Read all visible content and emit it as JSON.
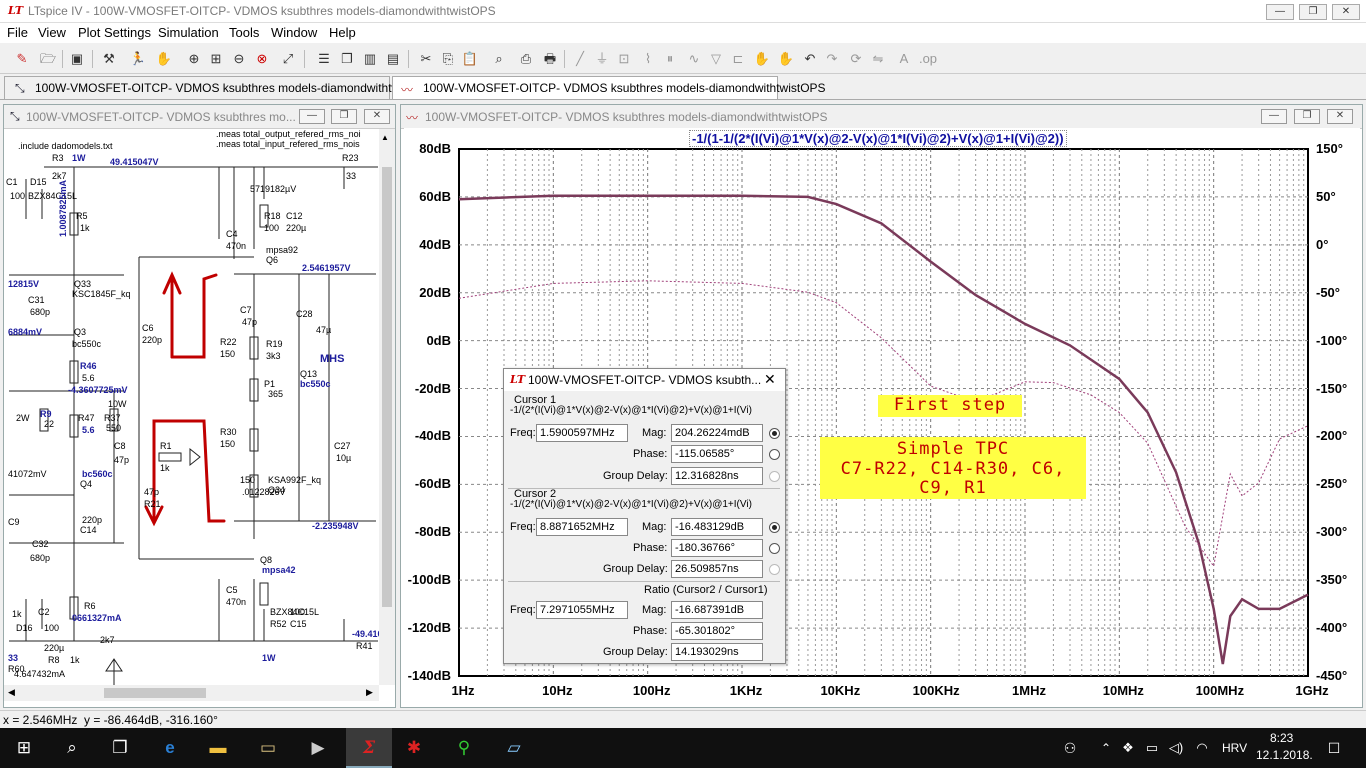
{
  "app": {
    "window_title": "LTspice IV - 100W-VMOSFET-OITCP- VDMOS ksubthres models-diamondwithtwistOPS",
    "window_buttons": [
      "—",
      "❐",
      "✕"
    ]
  },
  "menus": [
    "File",
    "View",
    "Plot Settings",
    "Simulation",
    "Tools",
    "Window",
    "Help"
  ],
  "tabs": [
    {
      "label": "100W-VMOSFET-OITCP- VDMOS ksubthres models-diamondwithtwistOPS",
      "icon": "schematic-icon"
    },
    {
      "label": "100W-VMOSFET-OITCP- VDMOS ksubthres models-diamondwithtwistOPS",
      "icon": "waveform-icon"
    }
  ],
  "schematic_window": {
    "title": "100W-VMOSFET-OITCP- VDMOS ksubthres mo...",
    "labels": [
      ".include dadomodels.txt",
      ".meas total_output_refered_rms_noi",
      ".meas total_input_refered_rms_nois",
      "R3",
      "2k7",
      "1W",
      "49.415047V",
      "R23",
      "33",
      "C1",
      "D15",
      "100",
      "BZX84C15L",
      "R5",
      "1k",
      "1.0087825mA",
      "C4",
      "470n",
      "R18",
      "100",
      "C12",
      "220µ",
      "mpsa92",
      "Q6",
      "2.5461957V",
      "12815V",
      "Q33",
      "KSC1845F_kq",
      "C31",
      "680p",
      "6884mV",
      "Q3",
      "bc550c",
      "C6",
      "220p",
      "C7",
      "47p",
      "C28",
      "47µ",
      "R22",
      "150",
      "R19",
      "3k3",
      "MHS",
      "R46",
      "5.6",
      "-4.3607725mV",
      "P1",
      "365",
      "Q13",
      "bc550c",
      "2W",
      "R9",
      "22",
      "10W",
      "R47",
      "5.6",
      "R37",
      "550",
      "C8",
      "47p",
      "R1",
      "1k",
      "R30",
      "150",
      "C27",
      "10µ",
      "41072mV",
      "bc560c",
      "Q4",
      "C9",
      "220p",
      "C14",
      "47p",
      "R21",
      "150",
      ".0122826V",
      "KSA992F_kq",
      "Q34",
      "-2.235948V",
      "C32",
      "680p",
      "Q8",
      "mpsa42",
      "C5",
      "470n",
      "0661327mA",
      "R6",
      "1k",
      "C2",
      "D16",
      "100",
      "BZX84C15L",
      "R52",
      "100",
      "C15",
      "220µ",
      "R8",
      "2k7",
      "-49.410865V",
      "R41",
      "33",
      "R60",
      "1k",
      "1W",
      "5719182µV",
      "4.647432mA"
    ]
  },
  "plot_window": {
    "title": "100W-VMOSFET-OITCP- VDMOS ksubthres models-diamondwithtwistOPS",
    "trace_expression": "-1/(1-1/(2*(I(Vi)@1*V(x)@2-V(x)@1*I(Vi)@2)+V(x)@1+I(Vi)@2))"
  },
  "chart_data": {
    "type": "line",
    "title": "-1/(1-1/(2*(I(Vi)@1*V(x)@2-V(x)@1*I(Vi)@2)+V(x)@1+I(Vi)@2))",
    "x_scale": "log",
    "xlim_hz": [
      1,
      1000000000
    ],
    "x_ticks": [
      "1Hz",
      "10Hz",
      "100Hz",
      "1KHz",
      "10KHz",
      "100KHz",
      "1MHz",
      "10MHz",
      "100MHz",
      "1GHz"
    ],
    "ylim_db": [
      -140,
      80
    ],
    "y_ticks": [
      "80dB",
      "60dB",
      "40dB",
      "20dB",
      "0dB",
      "-20dB",
      "-40dB",
      "-60dB",
      "-80dB",
      "-100dB",
      "-120dB",
      "-140dB"
    ],
    "y2lim_deg": [
      -450,
      150
    ],
    "y2_ticks": [
      "150°",
      "50°",
      "0°",
      "-50°",
      "-100°",
      "-150°",
      "-200°",
      "-250°",
      "-300°",
      "-350°",
      "-400°",
      "-450°"
    ],
    "grid": true,
    "series": [
      {
        "name": "magnitude",
        "axis": "left",
        "color": "#7a3a5a",
        "style": "solid",
        "x": [
          1,
          10,
          100,
          1000,
          5000,
          10000,
          30000,
          100000,
          300000,
          1000000,
          3000000,
          10000000,
          20000000,
          40000000,
          70000000,
          100000000,
          125000000,
          150000000,
          200000000,
          300000000,
          500000000,
          1000000000
        ],
        "y": [
          59,
          60.5,
          60.5,
          60.5,
          60,
          57,
          49,
          33,
          19,
          7,
          -2,
          -16,
          -30,
          -55,
          -85,
          -112,
          -135,
          -115,
          -108,
          -112,
          -112,
          -106
        ]
      },
      {
        "name": "phase",
        "axis": "right",
        "color": "#a0407a",
        "style": "dotted",
        "x": [
          1,
          10,
          100,
          1000,
          5000,
          10000,
          30000,
          100000,
          300000,
          1000000,
          2000000,
          5000000,
          10000000,
          20000000,
          50000000,
          100000000,
          150000000,
          200000000,
          300000000,
          500000000,
          1000000000
        ],
        "y": [
          -20,
          -3,
          0,
          -3,
          -13,
          -25,
          -65,
          -120,
          -138,
          -115,
          -116,
          -130,
          -150,
          -185,
          -280,
          -325,
          -220,
          -245,
          -230,
          -180,
          -165
        ]
      }
    ]
  },
  "annotations": {
    "first_step": "First step",
    "tpc_lines": [
      "Simple TPC",
      "C7-R22, C14-R30, C6,",
      "C9, R1"
    ]
  },
  "cursor_window": {
    "title": "100W-VMOSFET-OITCP- VDMOS ksubth...",
    "cursor1": {
      "heading": "Cursor 1",
      "expr": "-1/(2*(I(Vi)@1*V(x)@2-V(x)@1*I(Vi)@2)+V(x)@1+I(Vi)",
      "freq_label": "Freq:",
      "freq": "1.5900597MHz",
      "mag_label": "Mag:",
      "mag": "204.26224mdB",
      "phase_label": "Phase:",
      "phase": "-115.06585°",
      "gd_label": "Group Delay:",
      "group_delay": "12.316828ns"
    },
    "cursor2": {
      "heading": "Cursor 2",
      "expr": "-1/(2*(I(Vi)@1*V(x)@2-V(x)@1*I(Vi)@2)+V(x)@1+I(Vi)",
      "freq_label": "Freq:",
      "freq": "8.8871652MHz",
      "mag_label": "Mag:",
      "mag": "-16.483129dB",
      "phase_label": "Phase:",
      "phase": "-180.36766°",
      "gd_label": "Group Delay:",
      "group_delay": "26.509857ns"
    },
    "ratio": {
      "heading": "Ratio (Cursor2 / Cursor1)",
      "freq_label": "Freq:",
      "freq": "7.2971055MHz",
      "mag_label": "Mag:",
      "mag": "-16.687391dB",
      "phase_label": "Phase:",
      "phase": "-65.301802°",
      "gd_label": "Group Delay:",
      "group_delay": "14.193029ns"
    }
  },
  "status": {
    "x": "x = 2.546MHz",
    "y": "y = -86.464dB, -316.160°"
  },
  "taskbar": {
    "language": "HRV",
    "time": "8:23",
    "date": "12.1.2018."
  }
}
